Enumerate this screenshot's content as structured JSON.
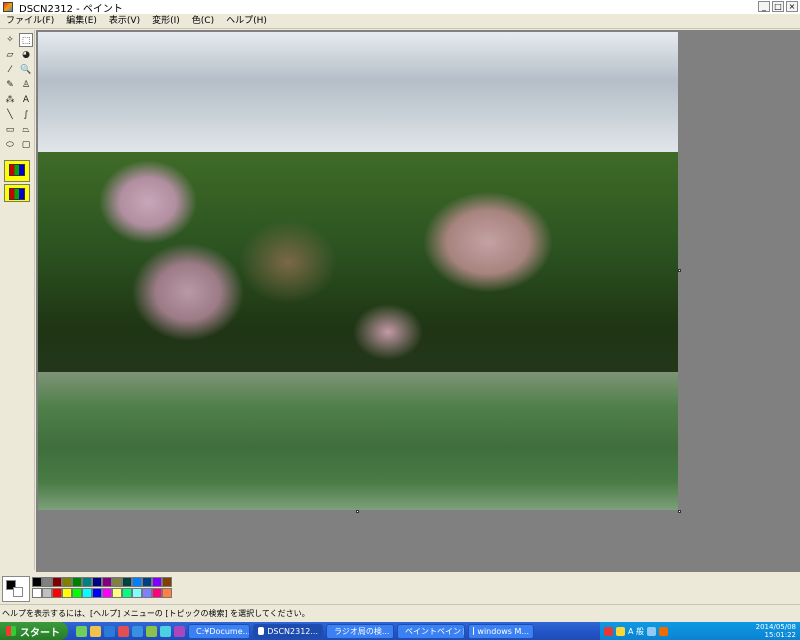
{
  "window": {
    "title": "DSCN2312 - ペイント",
    "controls": [
      "_",
      "□",
      "×"
    ]
  },
  "menu": [
    "ファイル(F)",
    "編集(E)",
    "表示(V)",
    "変形(I)",
    "色(C)",
    "ヘルプ(H)"
  ],
  "tools": [
    {
      "name": "free-select-tool",
      "glyph": "✧"
    },
    {
      "name": "rect-select-tool",
      "glyph": "⬚"
    },
    {
      "name": "eraser-tool",
      "glyph": "▱"
    },
    {
      "name": "fill-tool",
      "glyph": "◕"
    },
    {
      "name": "color-picker-tool",
      "glyph": "⁄"
    },
    {
      "name": "magnifier-tool",
      "glyph": "🔍"
    },
    {
      "name": "pencil-tool",
      "glyph": "✎"
    },
    {
      "name": "brush-tool",
      "glyph": "♙"
    },
    {
      "name": "airbrush-tool",
      "glyph": "⁂"
    },
    {
      "name": "text-tool",
      "glyph": "A"
    },
    {
      "name": "line-tool",
      "glyph": "╲"
    },
    {
      "name": "curve-tool",
      "glyph": "∫"
    },
    {
      "name": "rectangle-tool",
      "glyph": "▭"
    },
    {
      "name": "polygon-tool",
      "glyph": "⏢"
    },
    {
      "name": "ellipse-tool",
      "glyph": "⬭"
    },
    {
      "name": "rounded-rect-tool",
      "glyph": "▢"
    }
  ],
  "palette": {
    "foreground": "#000000",
    "background": "#ffffff",
    "top_row": [
      "#000000",
      "#808080",
      "#800000",
      "#808000",
      "#008000",
      "#008080",
      "#000080",
      "#800080",
      "#808040",
      "#004040",
      "#0080ff",
      "#004080",
      "#8000ff",
      "#804000"
    ],
    "bottom_row": [
      "#ffffff",
      "#c0c0c0",
      "#ff0000",
      "#ffff00",
      "#00ff00",
      "#00ffff",
      "#0000ff",
      "#ff00ff",
      "#ffff80",
      "#00ff80",
      "#80ffff",
      "#8080ff",
      "#ff0080",
      "#ff8040"
    ]
  },
  "status": {
    "text": "ヘルプを表示するには、[ヘルプ] メニューの [トピックの検索] を選択してください。"
  },
  "taskbar": {
    "start_label": "スタート",
    "quick_launch_colors": [
      "#6fcf5a",
      "#f2c14e",
      "#2a7bd8",
      "#e05050",
      "#3a90e0",
      "#8bc34a",
      "#4dd0e1",
      "#ab47bc"
    ],
    "tasks": [
      {
        "label": "C:¥Docume...",
        "active": false
      },
      {
        "label": "DSCN2312...",
        "active": true
      },
      {
        "label": "ラジオ局の検...",
        "active": false
      },
      {
        "label": "ペイントペイント",
        "active": false
      },
      {
        "label": "windows M...",
        "active": false
      }
    ],
    "tray_label": "A 般",
    "clock_date": "2014/05/08",
    "clock_time": "15:01:22"
  }
}
